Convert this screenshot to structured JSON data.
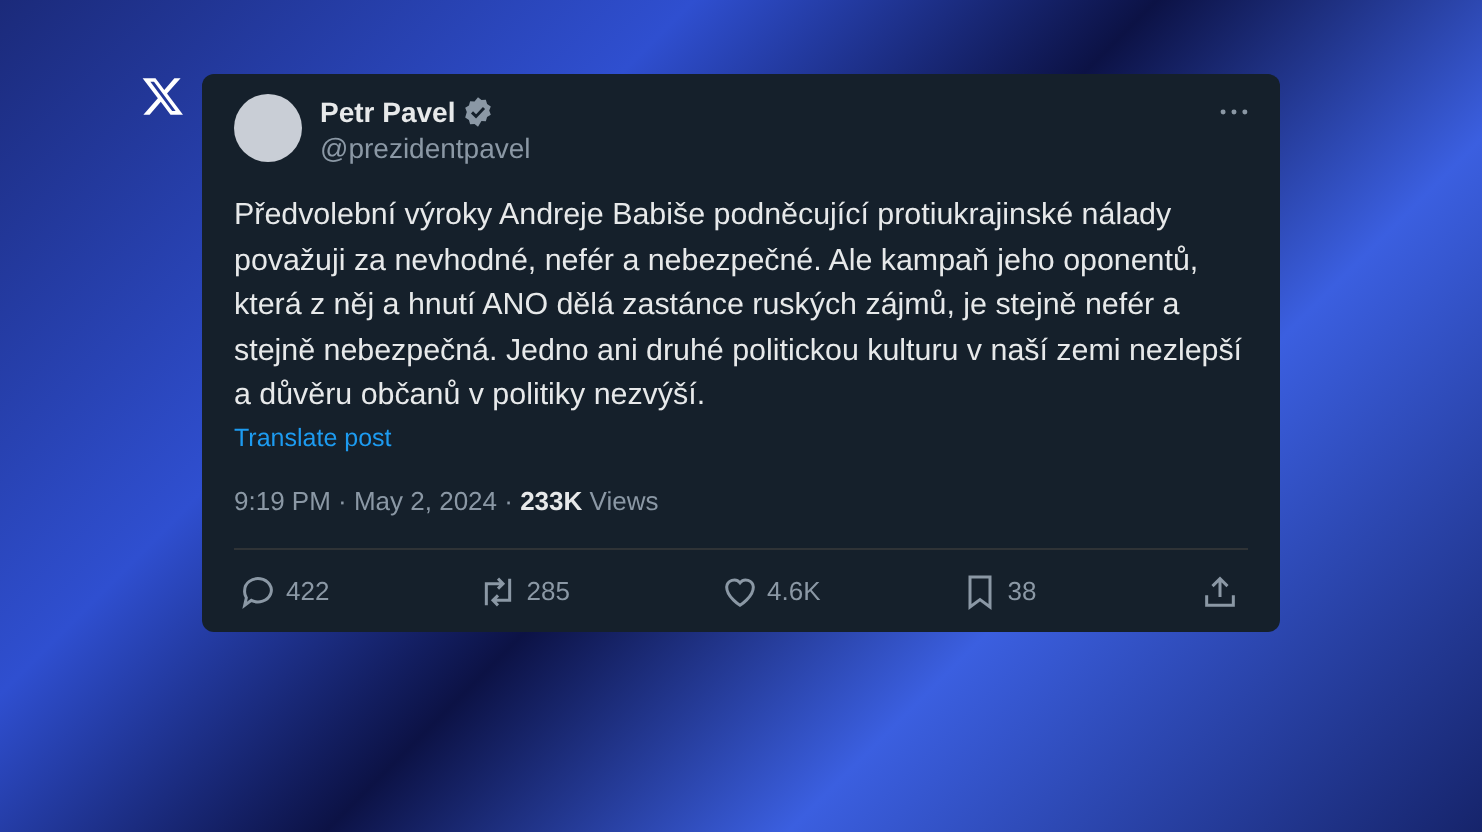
{
  "post": {
    "author": {
      "name": "Petr Pavel",
      "handle": "@prezidentpavel",
      "verified": true
    },
    "text": "Předvolební výroky Andreje Babiše podněcující protiukrajinské nálady považuji za nevhodné, nefér a nebezpečné. Ale kampaň jeho oponentů, která z něj a hnutí ANO dělá zastánce ruských zájmů, je stejně nefér a stejně nebezpečná. Jedno ani druhé politickou kulturu v naší zemi nezlepší a důvěru občanů v politiky nezvýší.",
    "translate": "Translate post",
    "meta": "9:19 PM · May 2, 2024 · **233K** Views",
    "actions": [
      {
        "kind": "reply",
        "count": "422"
      },
      {
        "kind": "repost",
        "count": "285"
      },
      {
        "kind": "like",
        "count": "4.6K"
      },
      {
        "kind": "bookmark",
        "count": "38"
      },
      {
        "kind": "share"
      }
    ]
  }
}
